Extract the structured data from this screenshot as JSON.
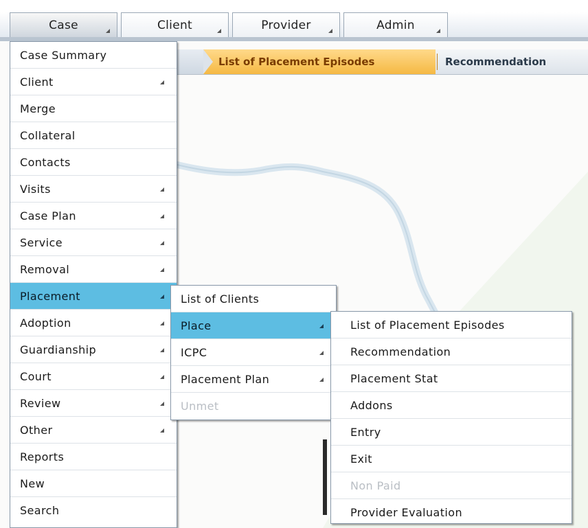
{
  "topbar": {
    "buttons": [
      {
        "label": "Case"
      },
      {
        "label": "Client"
      },
      {
        "label": "Provider"
      },
      {
        "label": "Admin"
      }
    ]
  },
  "breadcrumb": {
    "active": "List of Placement Episodes",
    "next": "Recommendation"
  },
  "case_menu": {
    "items": [
      {
        "label": "Case Summary"
      },
      {
        "label": "Client"
      },
      {
        "label": "Merge"
      },
      {
        "label": "Collateral"
      },
      {
        "label": "Contacts"
      },
      {
        "label": "Visits"
      },
      {
        "label": "Case Plan"
      },
      {
        "label": "Service"
      },
      {
        "label": "Removal"
      },
      {
        "label": "Placement"
      },
      {
        "label": "Adoption"
      },
      {
        "label": "Guardianship"
      },
      {
        "label": "Court"
      },
      {
        "label": "Review"
      },
      {
        "label": "Other"
      },
      {
        "label": "Reports"
      },
      {
        "label": "New"
      },
      {
        "label": "Search"
      }
    ]
  },
  "placement_menu": {
    "items": [
      {
        "label": "List of Clients"
      },
      {
        "label": "Place"
      },
      {
        "label": "ICPC"
      },
      {
        "label": "Placement Plan"
      },
      {
        "label": "Unmet"
      }
    ]
  },
  "place_menu": {
    "items": [
      {
        "label": "List of Placement Episodes"
      },
      {
        "label": "Recommendation"
      },
      {
        "label": "Placement Stat"
      },
      {
        "label": "Addons"
      },
      {
        "label": "Entry"
      },
      {
        "label": "Exit"
      },
      {
        "label": "Non Paid"
      },
      {
        "label": "Provider Evaluation"
      }
    ]
  },
  "colors": {
    "highlight": "#5dbde2",
    "breadcrumb_active": "#f5b944"
  }
}
